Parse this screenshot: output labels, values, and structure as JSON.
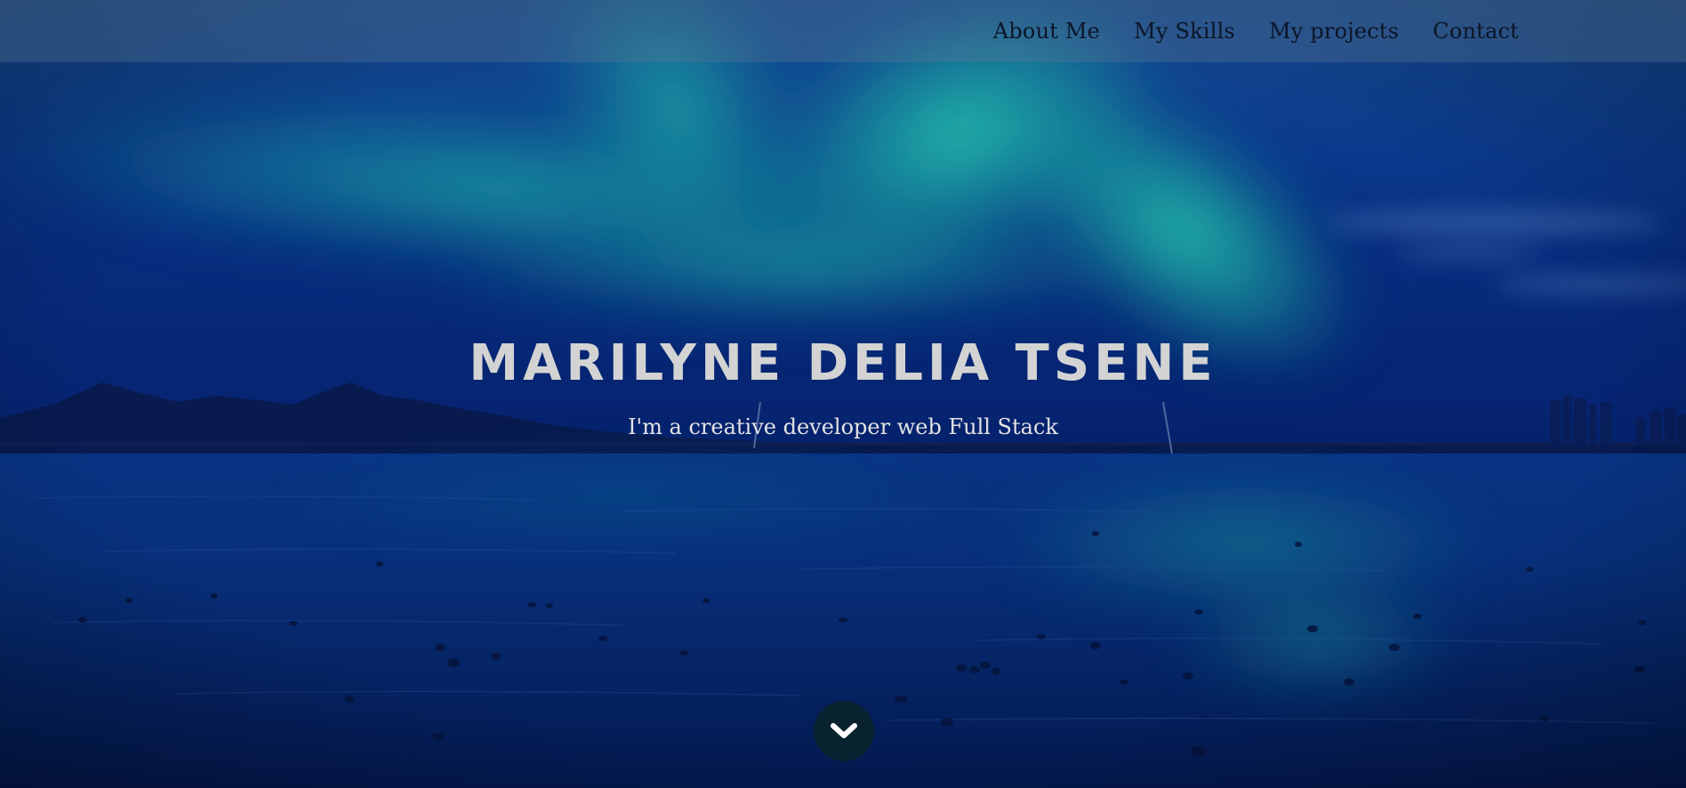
{
  "nav": {
    "items": [
      {
        "label": "About Me"
      },
      {
        "label": "My Skills"
      },
      {
        "label": "My projects"
      },
      {
        "label": "Contact"
      }
    ]
  },
  "hero": {
    "title": "MARILYNE DELIA TSENE",
    "subtitle": "I'm a creative developer web Full Stack",
    "background": "aurora-over-sea-photo",
    "scroll_icon": "chevron-down-icon"
  },
  "colors": {
    "nav_bg": "#5a7896",
    "nav_text": "#0b1528",
    "title_text": "#d3d3d3",
    "aurora": "#2ee6c8",
    "sky_deep": "#0a2f8a",
    "sea_deep": "#06205f",
    "scroll_button_bg": "#0a232d"
  }
}
